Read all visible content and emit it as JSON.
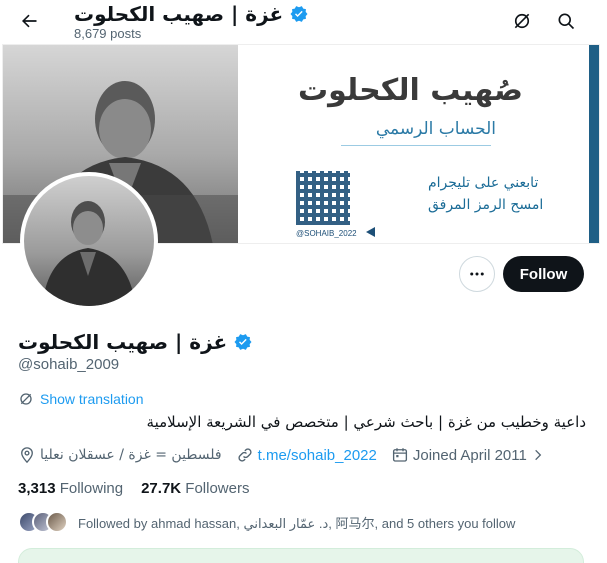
{
  "header": {
    "title": "غزة | صهيب الكحلوت",
    "posts_count": "8,679 posts"
  },
  "banner": {
    "name_text": "صُهيب الكحلوت",
    "subtitle": "الحساب الرسمي",
    "telegram_line1": "تابعني على تليجرام",
    "telegram_line2": "امسح الرمز المرفق",
    "handle_text": "@SOHAIB_2022"
  },
  "actions": {
    "follow_label": "Follow"
  },
  "profile": {
    "display_name": "غزة | صهيب الكحلوت",
    "handle": "@sohaib_2009",
    "show_translation": "Show translation",
    "bio": "داعية وخطيب من غزة | باحث شرعي | متخصص في الشريعة الإسلامية",
    "location": "فلسطين = غزة / عسقلان نعليا",
    "website": "t.me/sohaib_2022",
    "joined": "Joined April 2011"
  },
  "stats": {
    "following_count": "3,313",
    "following_label": "Following",
    "followers_count": "27.7K",
    "followers_label": "Followers"
  },
  "followed_by": {
    "text": "Followed by ahmad hassan, د. عمّار البعداني, 阿马尔, and 5 others you follow"
  },
  "colors": {
    "accent": "#1d9bf0",
    "verified": "#1d9bf0",
    "follow_button": "#0f1419",
    "muted_text": "#536471"
  },
  "icons": [
    "back-arrow-icon",
    "grok-icon",
    "search-icon",
    "verified-badge-icon",
    "more-icon",
    "translate-icon",
    "location-icon",
    "link-icon",
    "calendar-icon"
  ]
}
